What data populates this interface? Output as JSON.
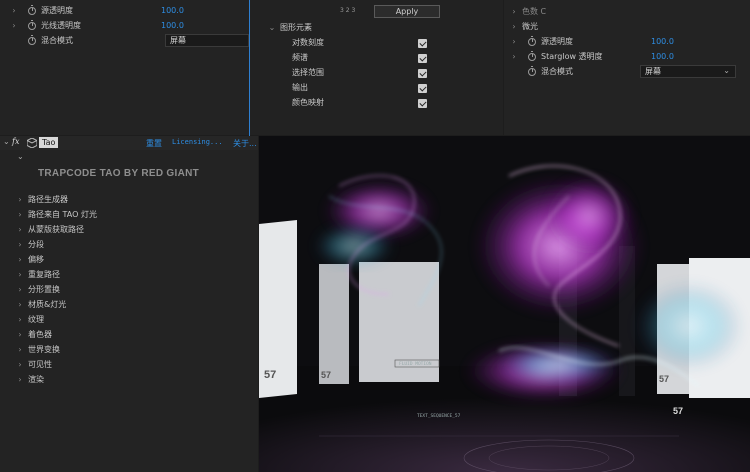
{
  "top_left": {
    "rows": [
      {
        "label": "源透明度",
        "value": "100.0"
      },
      {
        "label": "光线透明度",
        "value": "100.0"
      }
    ],
    "blend_label": "混合模式",
    "blend_value": "屏幕"
  },
  "top_middle": {
    "header_glyph": "3 2 3",
    "apply_label": "Apply",
    "group_label": "图形元素",
    "checkbox_items": [
      "对数刻度",
      "频谱",
      "选择范围",
      "输出",
      "颜色映射"
    ]
  },
  "top_right": {
    "row_truncated": "色数 C",
    "group_label": "微光",
    "rows": [
      {
        "label": "源透明度",
        "value": "100.0"
      },
      {
        "label": "Starglow 透明度",
        "value": "100.0"
      }
    ],
    "blend_label": "混合模式",
    "blend_value": "屏幕"
  },
  "effect_header": {
    "fx_label": "fx",
    "effect_name": "Tao",
    "reset_label": "重置",
    "licensing_label": "Licensing...",
    "about_label": "关于..."
  },
  "plugin_title": "TRAPCODE TAO BY RED GIANT",
  "effect_groups": [
    "路径生成器",
    "路径来自 TAO 灯光",
    "从蒙版获取路径",
    "分段",
    "偏移",
    "重复路径",
    "分形置换",
    "材质&灯光",
    "纹理",
    "着色器",
    "世界变换",
    "可见性",
    "渲染"
  ],
  "scene": {
    "left_screen_number": "57",
    "center_screen_number": "57",
    "right_screen_number": "57",
    "far_right_number": "57",
    "hud_text_1": "FLUID MOTION",
    "hud_text_2": "TEXT_SEQUENCE_57"
  },
  "colors": {
    "accent_blue": "#2e8ee4",
    "panel_bg": "#232323",
    "particle_magenta": "#c23bd6",
    "particle_cyan": "#49c8e8"
  }
}
